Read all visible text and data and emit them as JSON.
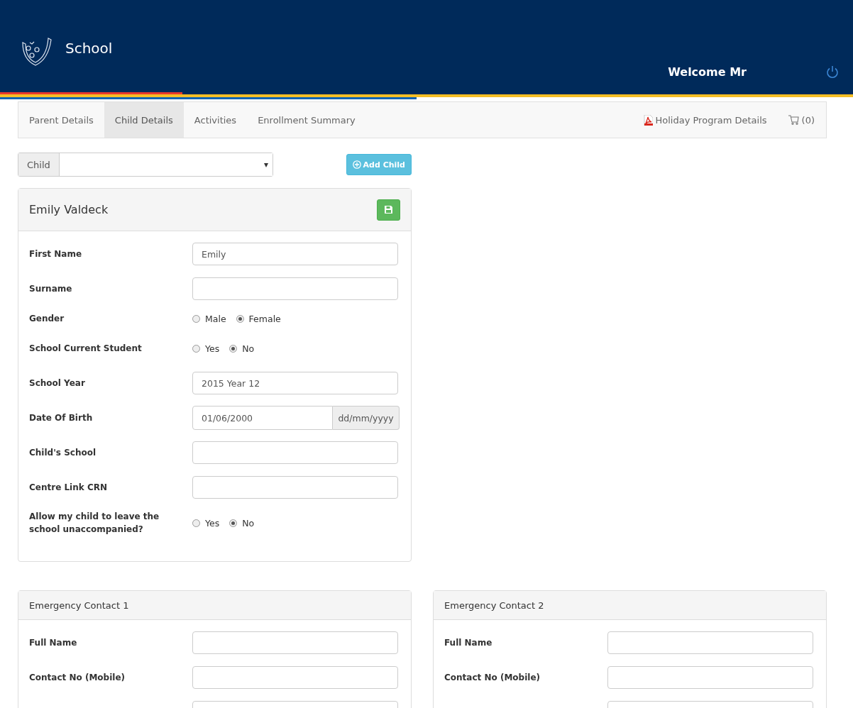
{
  "header": {
    "title": "School",
    "welcome": "Welcome Mr"
  },
  "nav": {
    "tabs": [
      {
        "label": "Parent Details",
        "selected": false
      },
      {
        "label": "Child Details",
        "selected": true
      },
      {
        "label": "Activities",
        "selected": false
      },
      {
        "label": "Enrollment Summary",
        "selected": false
      }
    ],
    "holiday_link": "Holiday Program Details",
    "cart": "(0)"
  },
  "child_select": {
    "label": "Child",
    "caret": "▾"
  },
  "add_child": "Add Child",
  "child_panel": {
    "title": "Emily Valdeck",
    "fields": [
      {
        "kind": "text",
        "label": "First Name",
        "value": "Emily"
      },
      {
        "kind": "text",
        "label": "Surname"
      },
      {
        "kind": "radio",
        "label": "Gender",
        "options": [
          {
            "label": "Male",
            "selected": false
          },
          {
            "label": "Female",
            "selected": true
          }
        ]
      },
      {
        "kind": "radio",
        "label": "School Current Student",
        "options": [
          {
            "label": "Yes",
            "selected": false
          },
          {
            "label": "No",
            "selected": true
          }
        ]
      },
      {
        "kind": "text",
        "label": "School Year",
        "value": "2015 Year 12"
      },
      {
        "kind": "date",
        "label": "Date Of Birth",
        "value": "01/06/2000",
        "addon": "dd/mm/yyyy"
      },
      {
        "kind": "text",
        "label": "Child's School"
      },
      {
        "kind": "text",
        "label": "Centre Link CRN"
      },
      {
        "kind": "radio",
        "label": "Allow my child to leave the school unaccompanied?",
        "options": [
          {
            "label": "Yes",
            "selected": false
          },
          {
            "label": "No",
            "selected": true
          }
        ]
      }
    ]
  },
  "emergency_contacts": [
    {
      "title": "Emergency Contact 1",
      "fields": [
        {
          "kind": "text",
          "label": "Full Name"
        },
        {
          "kind": "text",
          "label": "Contact No (Mobile)"
        }
      ]
    },
    {
      "title": "Emergency Contact 2",
      "fields": [
        {
          "kind": "text",
          "label": "Full Name"
        },
        {
          "kind": "text",
          "label": "Contact No (Mobile)"
        }
      ]
    }
  ]
}
